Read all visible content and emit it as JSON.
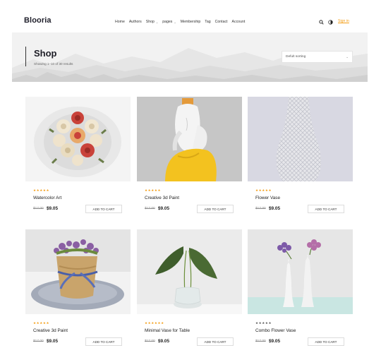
{
  "header": {
    "logo": "Blooria",
    "nav": [
      {
        "label": "Home",
        "caret": false
      },
      {
        "label": "Authors",
        "caret": false
      },
      {
        "label": "Shop",
        "caret": true
      },
      {
        "label": "pages",
        "caret": true
      },
      {
        "label": "Membership",
        "caret": false
      },
      {
        "label": "Tag",
        "caret": false
      },
      {
        "label": "Contact",
        "caret": false
      },
      {
        "label": "Account",
        "caret": false
      }
    ],
    "signin": "Sign in"
  },
  "banner": {
    "title": "Shop",
    "subtitle": "Showing 1–10 of 30 results",
    "sort_value": "Defult sorting"
  },
  "products": [
    {
      "name": "Watercolor Art",
      "rating": 5,
      "old_price": "$17.00",
      "price": "$9.05",
      "button": "ADD TO CART",
      "icon": "rose-bouquet"
    },
    {
      "name": "Creative 3d Paint",
      "rating": 5,
      "old_price": "$17.00",
      "price": "$9.05",
      "button": "ADD TO CART",
      "icon": "sculpture"
    },
    {
      "name": "Flower Vase",
      "rating": 5,
      "old_price": "$17.00",
      "price": "$9.05",
      "button": "ADD TO CART",
      "icon": "white-vase"
    },
    {
      "name": "Creative 3d Paint",
      "rating": 5,
      "old_price": "$17.00",
      "price": "$9.05",
      "button": "ADD TO CART",
      "icon": "burlap-flower-pot"
    },
    {
      "name": "Minimal Vase for Table",
      "rating": 6,
      "old_price": "$17.00",
      "price": "$9.05",
      "button": "ADD TO CART",
      "icon": "glass-vase-leaves"
    },
    {
      "name": "Combo Flower Vase",
      "rating": 5,
      "old_price": "$17.00",
      "price": "$9.05",
      "button": "ADD TO CART",
      "icon": "two-vases",
      "rating_color": "gray"
    }
  ],
  "colors": {
    "accent": "#f39c12",
    "dark": "#1e1e2a"
  }
}
